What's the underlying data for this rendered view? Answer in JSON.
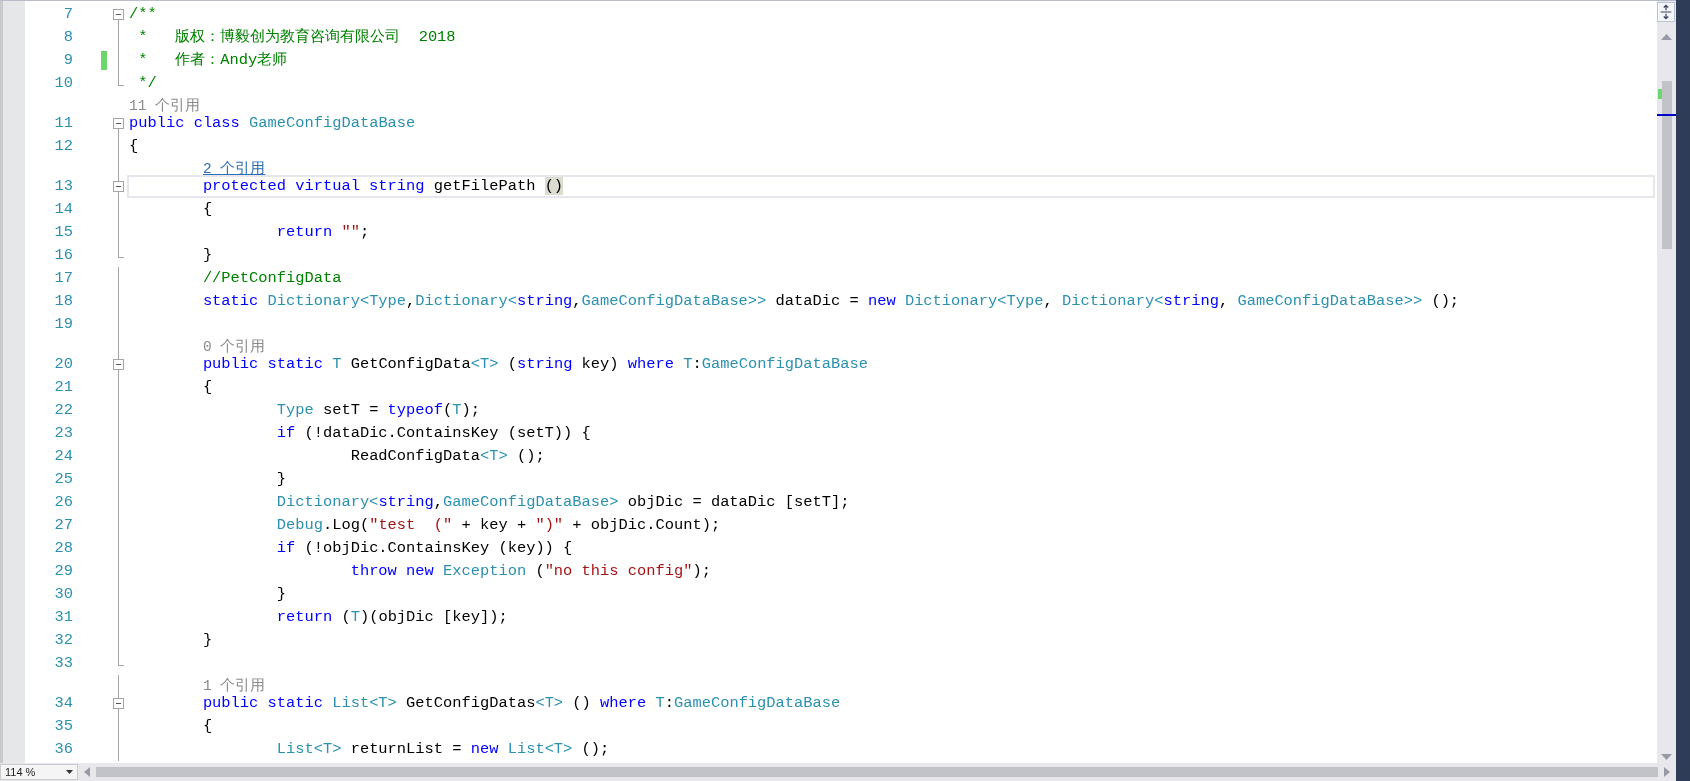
{
  "editor": {
    "lines": [
      {
        "kind": "code",
        "number": "7",
        "fold": {
          "kind": "start",
          "expanded": true
        },
        "tokens": [
          {
            "kind": "comment",
            "text": "/**"
          }
        ]
      },
      {
        "kind": "code",
        "number": "8",
        "fold": {
          "kind": "line"
        },
        "tokens": [
          {
            "kind": "comment",
            "text": " *   版权：博毅创为教育咨询有限公司  2018"
          }
        ]
      },
      {
        "kind": "code",
        "number": "9",
        "fold": {
          "kind": "line"
        },
        "changed": true,
        "tokens": [
          {
            "kind": "comment",
            "text": " *   作者：Andy老师"
          }
        ]
      },
      {
        "kind": "code",
        "number": "10",
        "fold": {
          "kind": "end"
        },
        "tokens": [
          {
            "kind": "comment",
            "text": " */"
          }
        ]
      },
      {
        "kind": "codelens",
        "text": "11 个引用",
        "hovered": false
      },
      {
        "kind": "code",
        "number": "11",
        "fold": {
          "kind": "start",
          "expanded": true
        },
        "tokens": [
          {
            "kind": "keyword",
            "text": "public class"
          },
          {
            "kind": "type",
            "text": " GameConfigDataBase"
          }
        ]
      },
      {
        "kind": "code",
        "number": "12",
        "fold": {
          "kind": "line"
        },
        "tokens": [
          {
            "kind": "plain",
            "text": "{"
          }
        ]
      },
      {
        "kind": "codelens",
        "fold": {
          "kind": "line"
        },
        "text": "2 个引用",
        "hovered": true
      },
      {
        "kind": "code",
        "number": "13",
        "fold": {
          "kind": "start",
          "expanded": true
        },
        "current": true,
        "tokens": [
          {
            "kind": "keyword",
            "text": "\tprotected virtual string"
          },
          {
            "kind": "plain",
            "text": " getFilePath "
          },
          {
            "kind": "brace_match",
            "text": "()"
          }
        ]
      },
      {
        "kind": "code",
        "number": "14",
        "fold": {
          "kind": "line"
        },
        "tokens": [
          {
            "kind": "plain",
            "text": "\t{"
          }
        ]
      },
      {
        "kind": "code",
        "number": "15",
        "fold": {
          "kind": "line"
        },
        "tokens": [
          {
            "kind": "keyword",
            "text": "\t\treturn"
          },
          {
            "kind": "string",
            "text": " \"\""
          },
          {
            "kind": "plain",
            "text": ";"
          }
        ]
      },
      {
        "kind": "code",
        "number": "16",
        "fold": {
          "kind": "end"
        },
        "tokens": [
          {
            "kind": "plain",
            "text": "\t}"
          }
        ]
      },
      {
        "kind": "code",
        "number": "17",
        "fold": {
          "kind": "line"
        },
        "tokens": [
          {
            "kind": "comment",
            "text": "\t//PetConfigData"
          }
        ]
      },
      {
        "kind": "code",
        "number": "18",
        "fold": {
          "kind": "line"
        },
        "tokens": [
          {
            "kind": "keyword",
            "text": "\tstatic"
          },
          {
            "kind": "type",
            "text": " Dictionary<Type"
          },
          {
            "kind": "plain",
            "text": ","
          },
          {
            "kind": "type",
            "text": "Dictionary<"
          },
          {
            "kind": "keyword",
            "text": "string"
          },
          {
            "kind": "plain",
            "text": ","
          },
          {
            "kind": "type",
            "text": "GameConfigDataBase>>"
          },
          {
            "kind": "plain",
            "text": " dataDic = "
          },
          {
            "kind": "keyword",
            "text": "new"
          },
          {
            "kind": "type",
            "text": " Dictionary<Type"
          },
          {
            "kind": "plain",
            "text": ", "
          },
          {
            "kind": "type",
            "text": "Dictionary<"
          },
          {
            "kind": "keyword",
            "text": "string"
          },
          {
            "kind": "plain",
            "text": ", "
          },
          {
            "kind": "type",
            "text": "GameConfigDataBase>>"
          },
          {
            "kind": "plain",
            "text": " ();"
          }
        ]
      },
      {
        "kind": "code",
        "number": "19",
        "fold": {
          "kind": "line"
        }
      },
      {
        "kind": "codelens",
        "fold": {
          "kind": "line"
        },
        "text": "0 个引用",
        "hovered": false
      },
      {
        "kind": "code",
        "number": "20",
        "fold": {
          "kind": "start",
          "expanded": true
        },
        "tokens": [
          {
            "kind": "keyword",
            "text": "\tpublic static"
          },
          {
            "kind": "type",
            "text": " T"
          },
          {
            "kind": "plain",
            "text": " GetConfigData"
          },
          {
            "kind": "type",
            "text": "<T>"
          },
          {
            "kind": "plain",
            "text": " ("
          },
          {
            "kind": "keyword",
            "text": "string"
          },
          {
            "kind": "plain",
            "text": " key) "
          },
          {
            "kind": "keyword",
            "text": "where"
          },
          {
            "kind": "type",
            "text": " T"
          },
          {
            "kind": "plain",
            "text": ":"
          },
          {
            "kind": "type",
            "text": "GameConfigDataBase"
          }
        ]
      },
      {
        "kind": "code",
        "number": "21",
        "fold": {
          "kind": "line"
        },
        "tokens": [
          {
            "kind": "plain",
            "text": "\t{"
          }
        ]
      },
      {
        "kind": "code",
        "number": "22",
        "fold": {
          "kind": "line"
        },
        "tokens": [
          {
            "kind": "type",
            "text": "\t\tType"
          },
          {
            "kind": "plain",
            "text": " setT = "
          },
          {
            "kind": "keyword",
            "text": "typeof"
          },
          {
            "kind": "plain",
            "text": "("
          },
          {
            "kind": "type",
            "text": "T"
          },
          {
            "kind": "plain",
            "text": ");"
          }
        ]
      },
      {
        "kind": "code",
        "number": "23",
        "fold": {
          "kind": "line"
        },
        "tokens": [
          {
            "kind": "keyword",
            "text": "\t\tif"
          },
          {
            "kind": "plain",
            "text": " (!dataDic.ContainsKey (setT)) {"
          }
        ]
      },
      {
        "kind": "code",
        "number": "24",
        "fold": {
          "kind": "line"
        },
        "tokens": [
          {
            "kind": "plain",
            "text": "\t\t\tReadConfigData"
          },
          {
            "kind": "type",
            "text": "<T>"
          },
          {
            "kind": "plain",
            "text": " ();"
          }
        ]
      },
      {
        "kind": "code",
        "number": "25",
        "fold": {
          "kind": "line"
        },
        "tokens": [
          {
            "kind": "plain",
            "text": "\t\t}"
          }
        ]
      },
      {
        "kind": "code",
        "number": "26",
        "fold": {
          "kind": "line"
        },
        "tokens": [
          {
            "kind": "type",
            "text": "\t\tDictionary<"
          },
          {
            "kind": "keyword",
            "text": "string"
          },
          {
            "kind": "plain",
            "text": ","
          },
          {
            "kind": "type",
            "text": "GameConfigDataBase>"
          },
          {
            "kind": "plain",
            "text": " objDic = dataDic [setT];"
          }
        ]
      },
      {
        "kind": "code",
        "number": "27",
        "fold": {
          "kind": "line"
        },
        "tokens": [
          {
            "kind": "type",
            "text": "\t\tDebug"
          },
          {
            "kind": "plain",
            "text": ".Log("
          },
          {
            "kind": "string",
            "text": "\"test  (\""
          },
          {
            "kind": "plain",
            "text": " + key + "
          },
          {
            "kind": "string",
            "text": "\")\""
          },
          {
            "kind": "plain",
            "text": " + objDic.Count);"
          }
        ]
      },
      {
        "kind": "code",
        "number": "28",
        "fold": {
          "kind": "line"
        },
        "tokens": [
          {
            "kind": "keyword",
            "text": "\t\tif"
          },
          {
            "kind": "plain",
            "text": " (!objDic.ContainsKey (key)) {"
          }
        ]
      },
      {
        "kind": "code",
        "number": "29",
        "fold": {
          "kind": "line"
        },
        "tokens": [
          {
            "kind": "keyword",
            "text": "\t\t\tthrow new"
          },
          {
            "kind": "type",
            "text": " Exception"
          },
          {
            "kind": "plain",
            "text": " ("
          },
          {
            "kind": "string",
            "text": "\"no this config\""
          },
          {
            "kind": "plain",
            "text": ");"
          }
        ]
      },
      {
        "kind": "code",
        "number": "30",
        "fold": {
          "kind": "line"
        },
        "tokens": [
          {
            "kind": "plain",
            "text": "\t\t}"
          }
        ]
      },
      {
        "kind": "code",
        "number": "31",
        "fold": {
          "kind": "line"
        },
        "tokens": [
          {
            "kind": "keyword",
            "text": "\t\treturn"
          },
          {
            "kind": "plain",
            "text": " ("
          },
          {
            "kind": "type",
            "text": "T"
          },
          {
            "kind": "plain",
            "text": ")(objDic [key]);"
          }
        ]
      },
      {
        "kind": "code",
        "number": "32",
        "fold": {
          "kind": "line"
        },
        "tokens": [
          {
            "kind": "plain",
            "text": "\t}"
          }
        ]
      },
      {
        "kind": "code",
        "number": "33",
        "fold": {
          "kind": "end"
        }
      },
      {
        "kind": "codelens",
        "fold": {
          "kind": "line"
        },
        "text": "1 个引用",
        "hovered": false
      },
      {
        "kind": "code",
        "number": "34",
        "fold": {
          "kind": "start",
          "expanded": true
        },
        "tokens": [
          {
            "kind": "keyword",
            "text": "\tpublic static"
          },
          {
            "kind": "type",
            "text": " List<T>"
          },
          {
            "kind": "plain",
            "text": " GetConfigDatas"
          },
          {
            "kind": "type",
            "text": "<T>"
          },
          {
            "kind": "plain",
            "text": " () "
          },
          {
            "kind": "keyword",
            "text": "where"
          },
          {
            "kind": "type",
            "text": " T"
          },
          {
            "kind": "plain",
            "text": ":"
          },
          {
            "kind": "type",
            "text": "GameConfigDataBase"
          }
        ]
      },
      {
        "kind": "code",
        "number": "35",
        "fold": {
          "kind": "line"
        },
        "tokens": [
          {
            "kind": "plain",
            "text": "\t{"
          }
        ]
      },
      {
        "kind": "code",
        "number": "36",
        "fold": {
          "kind": "line"
        },
        "tokens": [
          {
            "kind": "type",
            "text": "\t\tList<T>"
          },
          {
            "kind": "plain",
            "text": " returnList = "
          },
          {
            "kind": "keyword",
            "text": "new"
          },
          {
            "kind": "type",
            "text": " List<T>"
          },
          {
            "kind": "plain",
            "text": " ();"
          }
        ]
      }
    ]
  },
  "status_bar": {
    "zoom": "114 %"
  }
}
